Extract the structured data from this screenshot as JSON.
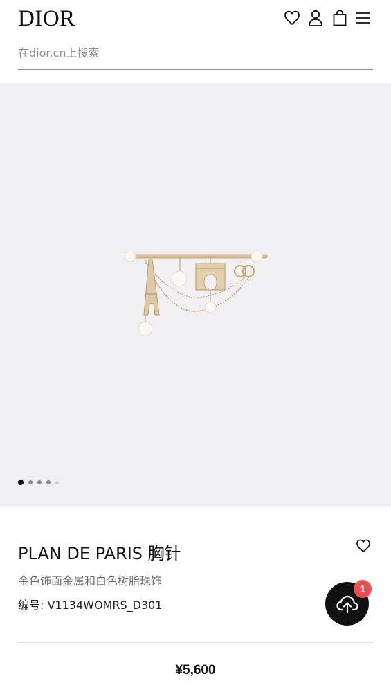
{
  "header": {
    "logo": "DIOR",
    "icons": [
      "heart-icon",
      "user-icon",
      "shopping-bag-icon",
      "menu-icon"
    ]
  },
  "search": {
    "placeholder": "在dior.cn上搜索",
    "value": ""
  },
  "gallery": {
    "image_count": 5,
    "active_index": 0
  },
  "product": {
    "title": "PLAN DE PARIS 胸针",
    "subtitle": "金色饰面金属和白色树脂珠饰",
    "ref": "编号: V1134WOMRS_D301",
    "price": "¥5,600"
  },
  "upload": {
    "badge_count": "1"
  },
  "colors": {
    "gallery_bg": "#f0f0f2",
    "badge": "#ef4e4e",
    "fab": "#111111"
  }
}
